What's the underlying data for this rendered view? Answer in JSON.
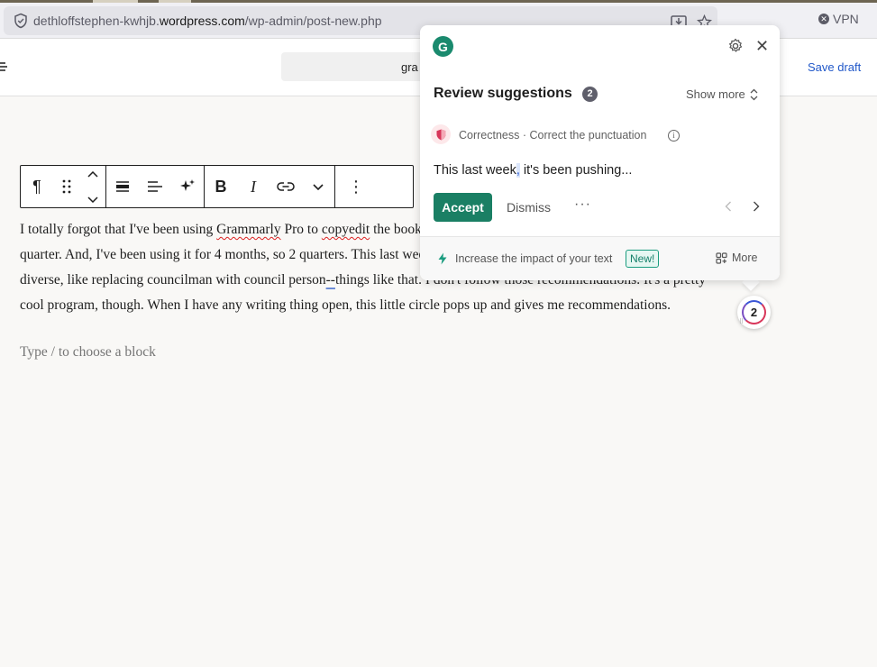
{
  "browser": {
    "url_prefix": "dethloffstephen-kwhjb.",
    "url_domain": "wordpress.com",
    "url_path": "/wp-admin/post-new.php",
    "vpn_label": "VPN",
    "icons": [
      "shield-icon",
      "download-icon",
      "star-icon",
      "close-icon"
    ]
  },
  "wp_header": {
    "doc_title_partial": "gra",
    "save_draft_label": "Save draft"
  },
  "block_toolbar": {
    "paragraph_icon": "¶",
    "drag_icon": "⠿",
    "bold_label": "B",
    "italic_label": "I",
    "options_icon": "⋮"
  },
  "post": {
    "line1_a": "I totally forgot that I've been using ",
    "line1_grammarly": "Grammarly",
    "line1_b": " Pro to ",
    "line1_copyedit": "copyedit",
    "line1_c": " the book.",
    "line2": "quarter. And, I've been using it for 4 months, so 2 quarters. This last week",
    "line3_a": "diverse, like replacing councilman with council person",
    "line3_dash": "--",
    "line3_b": "things like that. I don't follow those recommendations. It's a pretty",
    "line4": "cool program, though. When I have any writing thing open, this little circle pops up and gives me recommendations.",
    "placeholder": "Type / to choose a block"
  },
  "grammarly": {
    "logo_letter": "G",
    "title": "Review suggestions",
    "count": "2",
    "show_more_label": "Show more",
    "category": "Correctness · Correct the punctuation",
    "info_icon": "i",
    "sentence_before": "This last week",
    "sentence_highlight": ",",
    "sentence_after": " it's been pushing...",
    "accept_label": "Accept",
    "dismiss_label": "Dismiss",
    "more_dots": "···",
    "footer_text": "Increase the impact of your text",
    "new_badge": "New!",
    "more_label": "More",
    "circle_count": "2",
    "colors": {
      "accent": "#1a7f64",
      "correctness": "#d8365a"
    }
  }
}
